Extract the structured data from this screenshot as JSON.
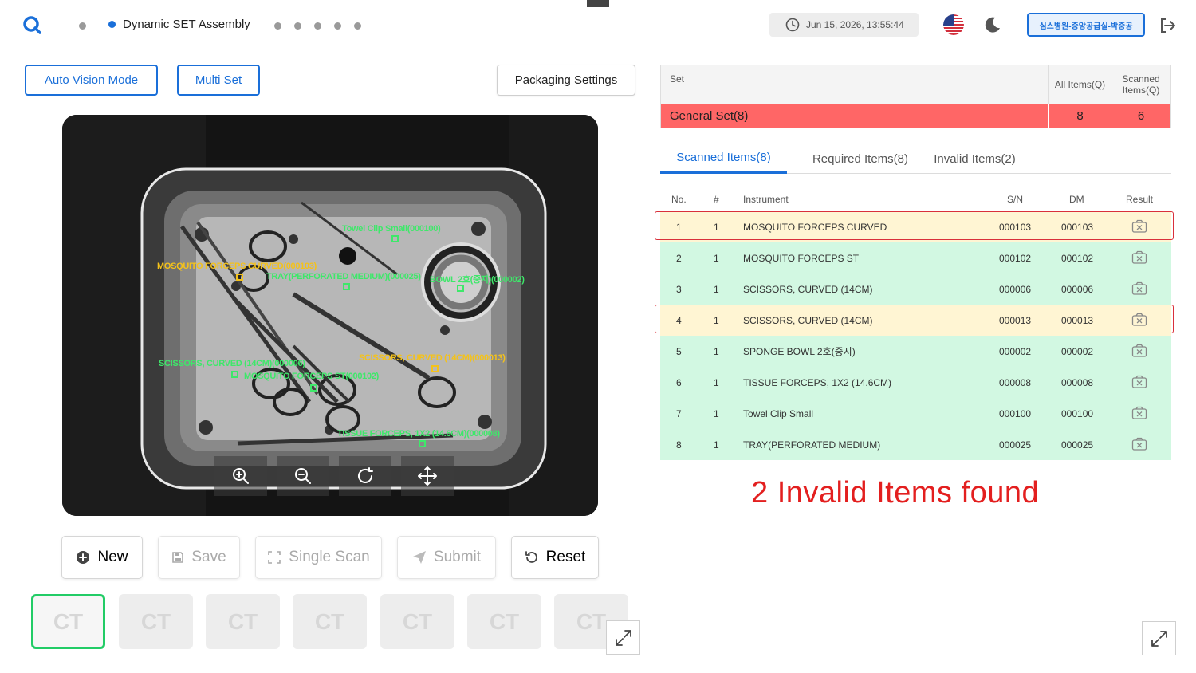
{
  "header": {
    "title": "Dynamic SET Assembly",
    "datetime": "Jun 15, 2026, 13:55:44",
    "user": "심스병원-중앙공급실-박중공"
  },
  "toolbar": {
    "auto_vision": "Auto Vision Mode",
    "multi_set": "Multi Set",
    "packaging": "Packaging Settings"
  },
  "camera": {
    "labels": [
      {
        "text": "Towel Clip Small(000100)",
        "color": "green"
      },
      {
        "text": "MOSQUITO FORCEPS CURVED(000103)",
        "color": "yellow"
      },
      {
        "text": "TRAY(PERFORATED MEDIUM)(000025)",
        "color": "green"
      },
      {
        "text": "BOWL 2호(중지)(000002)",
        "color": "green"
      },
      {
        "text": "SCISSORS, CURVED (14CM)(000006)",
        "color": "green"
      },
      {
        "text": "MOSQUITO FORCEPS ST(000102)",
        "color": "green"
      },
      {
        "text": "SCISSORS, CURVED (14CM)(000013)",
        "color": "yellow"
      },
      {
        "text": "TISSUE FORCEPS, 1X2 (14.6CM)(000008)",
        "color": "green"
      }
    ]
  },
  "actions": {
    "new": "New",
    "save": "Save",
    "single_scan": "Single Scan",
    "submit": "Submit",
    "reset": "Reset"
  },
  "thumbnails": [
    "CT",
    "CT",
    "CT",
    "CT",
    "CT",
    "CT",
    "CT"
  ],
  "set_table": {
    "col_set": "Set",
    "col_all": "All Items(Q)",
    "col_scanned": "Scanned Items(Q)",
    "row": {
      "name": "General Set(8)",
      "all": "8",
      "scanned": "6"
    }
  },
  "tabs": [
    {
      "label": "Scanned Items(8)",
      "active": true
    },
    {
      "label": "Required Items(8)",
      "active": false
    },
    {
      "label": "Invalid Items(2)",
      "active": false
    }
  ],
  "items_table": {
    "headers": [
      "No.",
      "#",
      "Instrument",
      "S/N",
      "DM",
      "Result"
    ],
    "rows": [
      {
        "no": "1",
        "count": "1",
        "instrument": "MOSQUITO FORCEPS CURVED",
        "sn": "000103",
        "dm": "000103",
        "invalid": true
      },
      {
        "no": "2",
        "count": "1",
        "instrument": "MOSQUITO FORCEPS ST",
        "sn": "000102",
        "dm": "000102",
        "invalid": false
      },
      {
        "no": "3",
        "count": "1",
        "instrument": "SCISSORS, CURVED (14CM)",
        "sn": "000006",
        "dm": "000006",
        "invalid": false
      },
      {
        "no": "4",
        "count": "1",
        "instrument": "SCISSORS, CURVED (14CM)",
        "sn": "000013",
        "dm": "000013",
        "invalid": true
      },
      {
        "no": "5",
        "count": "1",
        "instrument": "SPONGE BOWL 2호(중지)",
        "sn": "000002",
        "dm": "000002",
        "invalid": false
      },
      {
        "no": "6",
        "count": "1",
        "instrument": "TISSUE FORCEPS, 1X2 (14.6CM)",
        "sn": "000008",
        "dm": "000008",
        "invalid": false
      },
      {
        "no": "7",
        "count": "1",
        "instrument": "Towel Clip Small",
        "sn": "000100",
        "dm": "000100",
        "invalid": false
      },
      {
        "no": "8",
        "count": "1",
        "instrument": "TRAY(PERFORATED MEDIUM)",
        "sn": "000025",
        "dm": "000025",
        "invalid": false
      }
    ]
  },
  "invalid_message": "2 Invalid Items found",
  "colors": {
    "accent": "#1a6fd9",
    "set_row": "#ff6666",
    "valid_row": "#d2f8e2",
    "invalid_row": "#fff5d3",
    "invalid_text": "#e31f1f",
    "label_green": "#3ee86a",
    "label_yellow": "#f4c21a"
  }
}
